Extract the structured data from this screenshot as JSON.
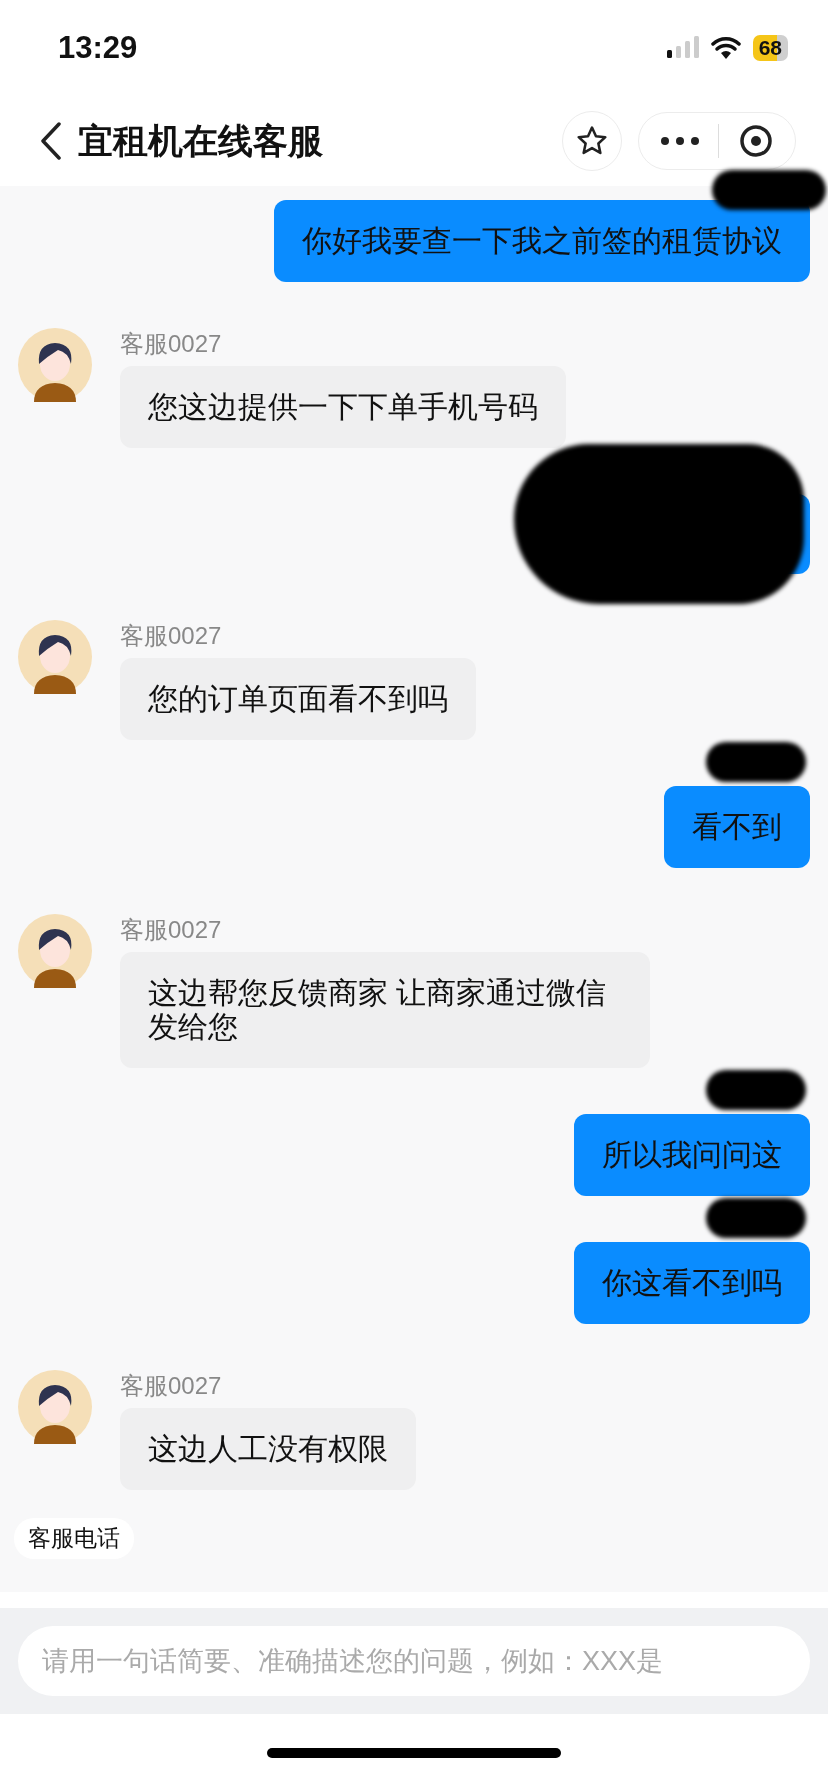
{
  "status_bar": {
    "time": "13:29",
    "battery": "68"
  },
  "header": {
    "title": "宜租机在线客服"
  },
  "messages": [
    {
      "kind": "user",
      "text": "你好我要查一下我之前签的租赁协议"
    },
    {
      "kind": "agent",
      "name": "客服0027",
      "text": "您这边提供一下下单手机号码"
    },
    {
      "kind": "user"
    },
    {
      "kind": "agent",
      "name": "客服0027",
      "text": "您的订单页面看不到吗"
    },
    {
      "kind": "user",
      "text": "看不到"
    },
    {
      "kind": "agent",
      "name": "客服0027",
      "text": "这边帮您反馈商家 让商家通过微信发给您"
    },
    {
      "kind": "user",
      "text": "所以我问问这"
    },
    {
      "kind": "user",
      "text": "你这看不到吗"
    },
    {
      "kind": "agent",
      "name": "客服0027",
      "text": "这边人工没有权限"
    }
  ],
  "quick_chip": "客服电话",
  "input": {
    "placeholder": "请用一句话简要、准确描述您的问题，例如：XXX是"
  }
}
